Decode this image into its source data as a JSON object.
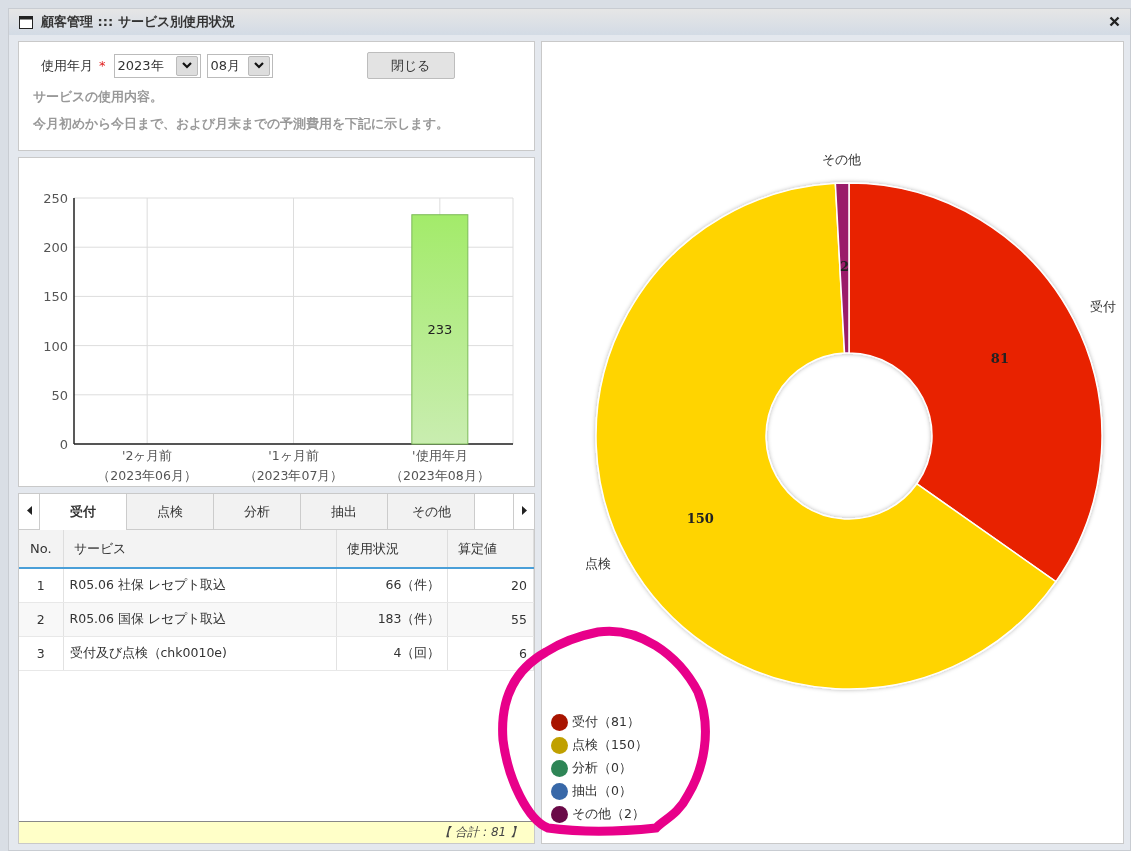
{
  "window": {
    "title": "顧客管理 ::: サービス別使用状況"
  },
  "form": {
    "label": "使用年月",
    "required_mark": "*",
    "year": "2023年",
    "month": "08月",
    "close_button": "閉じる",
    "notes": [
      "サービスの使用内容。",
      "今月初めから今日まで、および月末までの予測費用を下記に示します。"
    ]
  },
  "bar_panel": {
    "chart_data": {
      "type": "bar",
      "categories": [
        "'2ヶ月前",
        "'1ヶ月前",
        "'使用年月"
      ],
      "values": [
        0,
        0,
        233
      ],
      "ylim": [
        0,
        250
      ],
      "yticks": [
        0,
        50,
        100,
        150,
        200,
        250
      ],
      "grid": true,
      "value_labels": [
        null,
        null,
        "233"
      ]
    },
    "period_labels": [
      "（2023年06月）",
      "（2023年07月）",
      "（2023年08月）"
    ]
  },
  "tabs": [
    {
      "label": "受付",
      "selected": true
    },
    {
      "label": "点検",
      "selected": false
    },
    {
      "label": "分析",
      "selected": false
    },
    {
      "label": "抽出",
      "selected": false
    },
    {
      "label": "その他",
      "selected": false
    }
  ],
  "table": {
    "columns": [
      "No.",
      "サービス",
      "使用状況",
      "算定値"
    ],
    "rows": [
      [
        "1",
        "R05.06 社保 レセプト取込",
        "66（件）",
        "20"
      ],
      [
        "2",
        "R05.06 国保 レセプト取込",
        "183（件）",
        "55"
      ],
      [
        "3",
        "受付及び点検（chk0010e)",
        "4（回）",
        "6"
      ]
    ],
    "footer": "【 合計 : 81 】"
  },
  "pie_panel": {
    "chart_data": {
      "type": "donut",
      "categories": [
        "受付",
        "点検",
        "その他"
      ],
      "values": [
        81,
        150,
        2
      ],
      "colors": [
        "#e82000",
        "#ffd400",
        "#9a1a6a"
      ],
      "data_labels": true
    },
    "legend": [
      {
        "label": "受付（81）",
        "color": "#a81400"
      },
      {
        "label": "点検（150）",
        "color": "#c0a000"
      },
      {
        "label": "分析（0）",
        "color": "#2e8556"
      },
      {
        "label": "抽出（0）",
        "color": "#3868a8"
      },
      {
        "label": "その他（2）",
        "color": "#6a0a48"
      }
    ]
  }
}
